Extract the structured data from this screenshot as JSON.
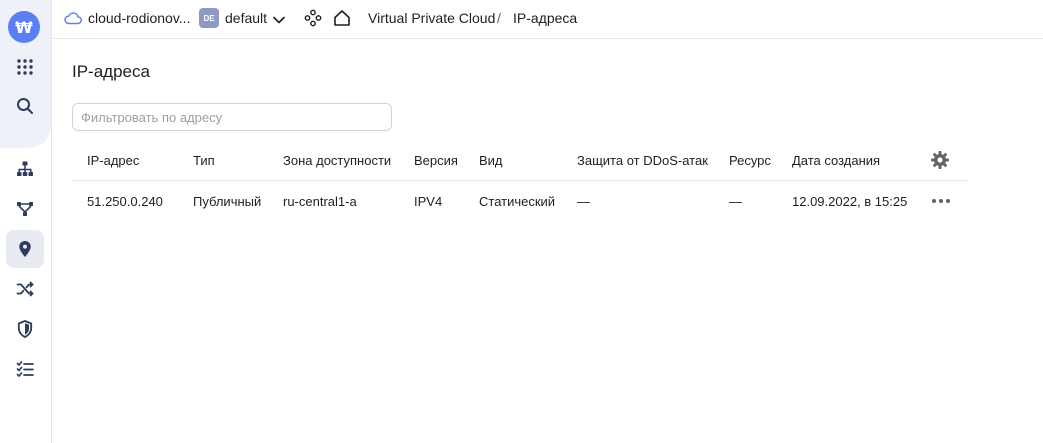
{
  "sidebar": {
    "logo_glyph": "₩",
    "items": [
      {
        "name": "apps",
        "icon": "grid-icon"
      },
      {
        "name": "search",
        "icon": "search-icon"
      },
      {
        "name": "networks",
        "icon": "network-icon"
      },
      {
        "name": "route-tables",
        "icon": "routes-icon"
      },
      {
        "name": "ip-addresses",
        "icon": "location-pin-icon",
        "active": true
      },
      {
        "name": "gateways",
        "icon": "shuffle-icon"
      },
      {
        "name": "security-groups",
        "icon": "shield-icon"
      },
      {
        "name": "operations",
        "icon": "checklist-icon"
      }
    ]
  },
  "topbar": {
    "cloud_label": "cloud-rodionov...",
    "folder_badge": "DE",
    "folder_label": "default",
    "breadcrumb_service": "Virtual Private Cloud",
    "breadcrumb_sep": "/",
    "breadcrumb_page": "IP-адреса"
  },
  "main": {
    "title": "IP-адреса",
    "filter_placeholder": "Фильтровать по адресу",
    "columns": [
      "IP-адрес",
      "Тип",
      "Зона доступности",
      "Версия",
      "Вид",
      "Защита от DDoS-атак",
      "Ресурс",
      "Дата создания"
    ],
    "rows": [
      {
        "ip": "51.250.0.240",
        "type": "Публичный",
        "zone": "ru-central1-a",
        "version": "IPV4",
        "kind": "Статический",
        "ddos": "—",
        "resource": "—",
        "created": "12.09.2022, в 15:25"
      }
    ]
  },
  "colors": {
    "accent": "#5b7ff3",
    "rail_top_bg": "#eef1f8",
    "active_item_bg": "#e7eaf1",
    "icon_color": "#2e3b5c"
  }
}
